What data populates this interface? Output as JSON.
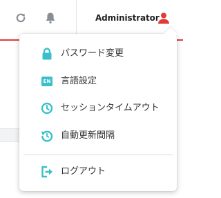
{
  "header": {
    "username": "Administrator",
    "icons": {
      "refresh": "refresh-icon",
      "notifications": "bell-icon",
      "user": "user-icon"
    }
  },
  "menu": {
    "items": [
      {
        "label": "パスワード変更",
        "icon": "lock-icon"
      },
      {
        "label": "言語設定",
        "icon": "en-icon",
        "icon_text": "EN"
      },
      {
        "label": "セッションタイムアウト",
        "icon": "clock-icon"
      },
      {
        "label": "自動更新間隔",
        "icon": "refresh-interval-icon"
      },
      {
        "label": "ログアウト",
        "icon": "logout-icon"
      }
    ]
  },
  "colors": {
    "accent_red": "#e23b36",
    "menu_icon_teal": "#3bbfc9",
    "header_icon_gray": "#8a8f96",
    "text": "#333333"
  }
}
